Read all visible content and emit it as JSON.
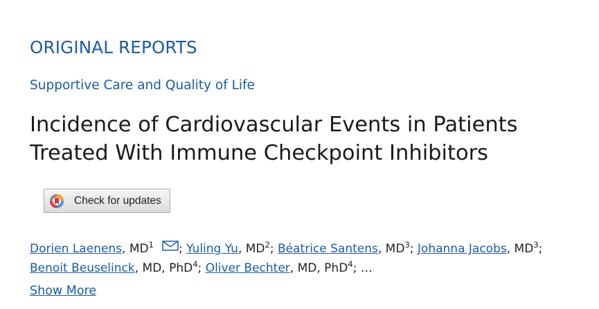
{
  "top_links": [
    "",
    "",
    ""
  ],
  "article": {
    "section": "ORIGINAL REPORTS",
    "subsection": "Supportive Care and Quality of Life",
    "title": "Incidence of Cardiovascular Events in Patients Treated With Immune Checkpoint Inhibitors",
    "check_updates_label": "Check for updates",
    "show_more_label": "Show More",
    "authors": [
      {
        "name": "Dorien Laenens",
        "degree": ", MD",
        "sup": "1"
      },
      {
        "name": "Yuling Yu",
        "degree": ", MD",
        "sup": "2"
      },
      {
        "name": "Béatrice Santens",
        "degree": ", MD",
        "sup": "3"
      },
      {
        "name": "Johanna Jacobs",
        "degree": ", MD",
        "sup": "3"
      },
      {
        "name": "Benoit Beuselinck",
        "degree": ", MD, PhD",
        "sup": "4"
      },
      {
        "name": "Oliver Bechter",
        "degree": ", MD, PhD",
        "sup": "4"
      }
    ],
    "separator": ";",
    "ellipsis": " …"
  },
  "colors": {
    "link": "#1c5aa6",
    "title": "#1a1a1a"
  },
  "icons": {
    "email": "envelope-icon",
    "crossmark": "crossmark-icon"
  }
}
